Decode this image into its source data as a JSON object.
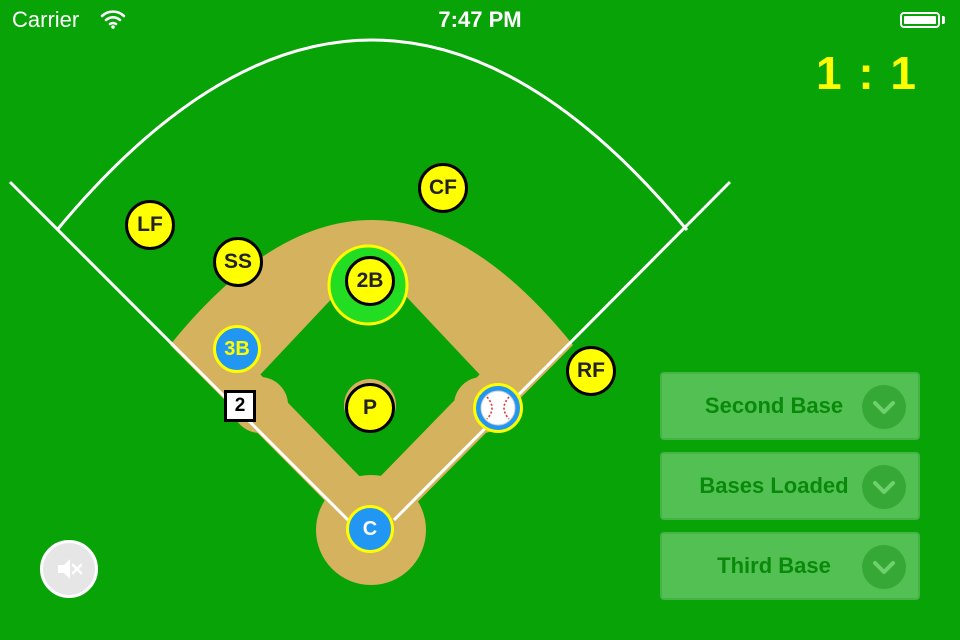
{
  "status_bar": {
    "carrier": "Carrier",
    "time": "7:47 PM",
    "wifi_icon": "wifi-icon",
    "battery_icon": "battery-full-icon"
  },
  "score": "1 : 1",
  "colors": {
    "grass": "#07a307",
    "dirt": "#d4b25e",
    "defender": "#ffff00",
    "runner": "#2196f3",
    "button": "#52c052",
    "button_text": "#0a8a0a",
    "score": "#ffff00"
  },
  "defense": {
    "lf": "LF",
    "cf": "CF",
    "rf": "RF",
    "ss": "SS",
    "second_base": "2B",
    "pitcher": "P"
  },
  "offense": {
    "third_base_runner": "3B",
    "catcher": "C",
    "batter_number": "2",
    "ball_icon": "baseball-icon"
  },
  "options": [
    {
      "label": "Second Base",
      "icon": "chevron-down-icon"
    },
    {
      "label": "Bases Loaded",
      "icon": "chevron-down-icon"
    },
    {
      "label": "Third Base",
      "icon": "chevron-down-icon"
    }
  ],
  "mute_icon": "speaker-mute-icon"
}
